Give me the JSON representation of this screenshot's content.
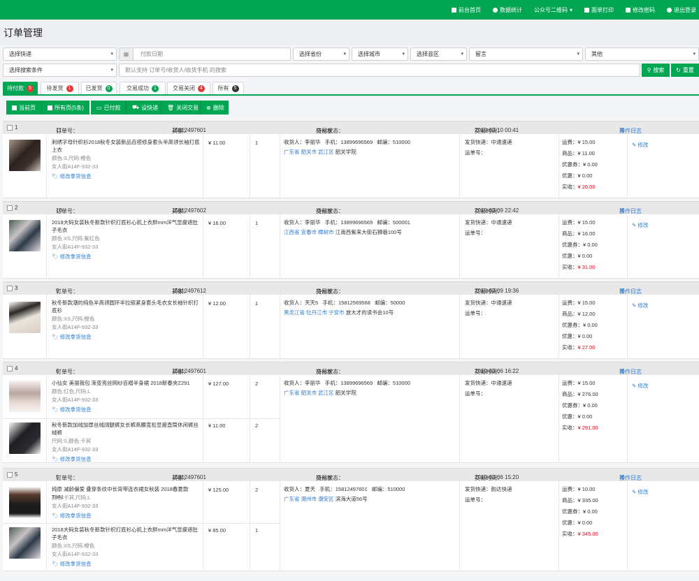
{
  "topnav": [
    "前台首页",
    "数据统计",
    "公众号二维码",
    "面单打印",
    "修改密码",
    "退出登录"
  ],
  "page_title": "订单管理",
  "filters": {
    "express": "选择快递",
    "pay_date": "付款日期",
    "province": "选择省份",
    "city": "选择城市",
    "county": "选择县区",
    "message": "留言",
    "other": "其他",
    "search_cond": "选择搜索条件",
    "search_placeholder": "默认支持 订单号/收货人/收货手机 的搜索",
    "search_btn": "搜索",
    "reset_btn": "重置"
  },
  "tabs": [
    {
      "label": "待付款",
      "count": "5",
      "color": "#e53935"
    },
    {
      "label": "待发货",
      "count": "1",
      "color": "#e53935"
    },
    {
      "label": "已发货",
      "count": "0",
      "color": "#00a651"
    },
    {
      "label": "交易成功",
      "count": "1",
      "color": "#00a651"
    },
    {
      "label": "交易关闭",
      "count": "4",
      "color": "#e53935"
    },
    {
      "label": "所有",
      "count": "5",
      "color": "#333333"
    }
  ],
  "actions": {
    "cur_page": "当前页",
    "all_pages": "所有页(5条)",
    "paid": "已付款",
    "set_express": "设快递",
    "close": "关闭交易",
    "delete": "删除"
  },
  "labels": {
    "order_no": "订单号：",
    "buyer": "买家：",
    "status": "交易状态：",
    "time": "交易时间：",
    "log": "操作日志",
    "receiver": "收货人：",
    "phone": "手机：",
    "zip": "邮编：",
    "ship": "发货快递：",
    "track": "运单号：",
    "freight": "运费：",
    "goods": "商品：",
    "coupon": "优惠券：",
    "discount": "优惠：",
    "actual": "实收：",
    "edit": "修改",
    "edit_info": "修改拿货信息"
  },
  "orders": [
    {
      "idx": "1",
      "no": "11",
      "buyer": "15812497601",
      "status": "待付款",
      "time": "2019-03-10 00:41",
      "receiver": "李丽华",
      "phone": "13899696569",
      "zip": "510000",
      "region": "广东省 韶关市 武江区",
      "addr": "韶关学院",
      "express": "中通速递",
      "freight": "¥ 15.00",
      "goods": "¥ 11.00",
      "coupon": "¥ 0.00",
      "discount": "¥ 0.00",
      "actual": "¥ 26.00",
      "items": [
        {
          "name": "刺绣字母针织衫2018秋冬女装新品百搭修身套头半高领长袖打底上衣",
          "spec": "颜色:S,尺码:橙色",
          "sku": "女人街A14F-932-33",
          "price": "¥ 11.00",
          "qty": "1"
        }
      ]
    },
    {
      "idx": "2",
      "no": "10",
      "buyer": "15812497602",
      "status": "待付款",
      "time": "2019-03-09 22:42",
      "receiver": "李丽华",
      "phone": "13899696569",
      "zip": "500001",
      "region": "江西省 宜春市 樟树市",
      "addr": "江南西紫来大街石狮巷100号",
      "express": "中通速递",
      "freight": "¥ 15.00",
      "goods": "¥ 16.00",
      "coupon": "¥ 0.00",
      "discount": "¥ 0.00",
      "actual": "¥ 31.00",
      "items": [
        {
          "name": "2018大码女装秋冬新款针织打底衫心机上衣胖mm洋气显瘦遮肚子毛衣",
          "spec": "颜色:XS,尺码:紫红色",
          "sku": "女人街A14F-932-33",
          "price": "¥ 16.00",
          "qty": "1"
        }
      ]
    },
    {
      "idx": "3",
      "no": "9",
      "buyer": "15812497612",
      "status": "待付款",
      "time": "2019-03-09 19:36",
      "receiver": "天天5",
      "phone": "15812569568",
      "zip": "50000",
      "region": "黑龙江省 牡丹江市 宁安市",
      "addr": "放大才的读书会10号",
      "express": "中通速递",
      "freight": "¥ 15.00",
      "goods": "¥ 12.00",
      "coupon": "¥ 0.00",
      "discount": "¥ 0.00",
      "actual": "¥ 27.00",
      "items": [
        {
          "name": "秋冬新款潮的纯色半高领圆环半拉链紧身套头毛衣女长袖针织打底衫",
          "spec": "颜色:XS,尺码:橙色",
          "sku": "女人街A14F-932-33",
          "price": "¥ 12.00",
          "qty": "1"
        }
      ]
    },
    {
      "idx": "4",
      "no": "6",
      "buyer": "15812497601",
      "status": "待付款",
      "time": "2019-03-06 16:22",
      "receiver": "李丽华",
      "phone": "13899696569",
      "zip": "510000",
      "region": "广东省 韶关市 武江区",
      "addr": "韶关学院",
      "express": "中通速递",
      "freight": "¥ 15.00",
      "goods": "¥ 276.00",
      "coupon": "¥ 0.00",
      "discount": "¥ 0.00",
      "actual": "¥ 291.00",
      "items": [
        {
          "name": "小仙女 美丽我包 渐变亮丝网纱百褶半身裙 2018新春夹Z291",
          "spec": "颜色:红色,尺码:L",
          "sku": "女人街A14F-932-33",
          "price": "¥ 127.00",
          "qty": "2"
        },
        {
          "name": "秋冬新款加绒加厚丝绒阔腿裤女长裤高腰宽松显瘦直筒休闲裤丝绒裤",
          "spec": "尺码:S,颜色:卡其",
          "sku": "女人街A14F-932-33",
          "price": "¥ 11.00",
          "qty": "2"
        }
      ]
    },
    {
      "idx": "5",
      "no": "5",
      "buyer": "15812497601",
      "status": "待付款",
      "time": "2019-03-06 15:20",
      "receiver": "夏天",
      "phone": "15812497601",
      "zip": "510000",
      "region": "广东省 潮州市 潮安区",
      "addr": "滨海大道56号",
      "express": "韵达快递",
      "freight": "¥ 10.00",
      "goods": "¥ 335.00",
      "coupon": "¥ 0.00",
      "discount": "¥ 0.00",
      "actual": "¥ 345.00",
      "items": [
        {
          "name": "纯原 减龄偏爱 叠穿条纹中长背带连衣裙女秋装 2018春夏款T941",
          "spec": "颜色:卡其,尺码:L",
          "sku": "女人街A14F-932-33",
          "price": "¥ 125.00",
          "qty": "2"
        },
        {
          "name": "2018大码女装秋冬新款针织打底衫心机上衣胖mm洋气显瘦遮肚子毛衣",
          "spec": "颜色:XS,尺码:橙色",
          "sku": "女人街A14F-932-33",
          "price": "¥ 85.00",
          "qty": "1"
        }
      ]
    }
  ],
  "colors": {
    "brand": "#00a651",
    "link": "#2d7bd1",
    "price_red": "#e60012"
  }
}
